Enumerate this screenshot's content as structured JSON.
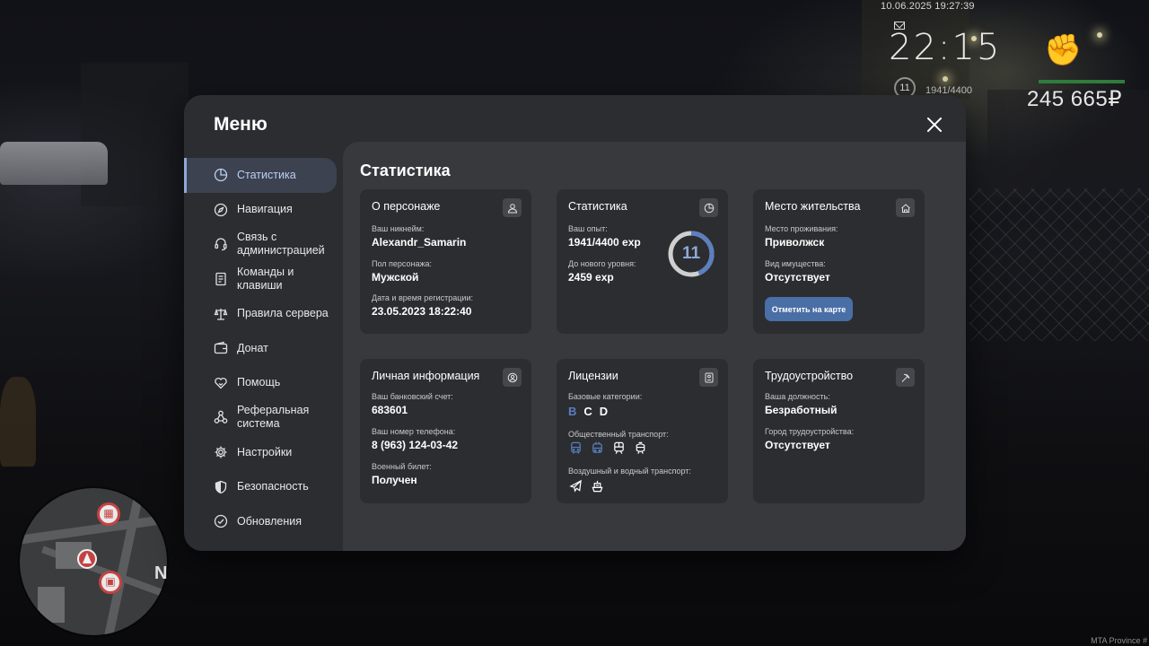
{
  "hud": {
    "datetime": "10.06.2025 19:27:39",
    "clock": "22:15",
    "level": "11",
    "level_exp": "1941/4400",
    "money": "245 665₽",
    "watermark": "MTA Province #",
    "north": "N"
  },
  "menu": {
    "title": "Меню",
    "sidebar": [
      {
        "label": "Статистика",
        "icon": "chart-pie-icon",
        "active": true
      },
      {
        "label": "Навигация",
        "icon": "compass-icon"
      },
      {
        "label": "Связь с администрацией",
        "icon": "headset-icon"
      },
      {
        "label": "Команды и клавиши",
        "icon": "document-icon"
      },
      {
        "label": "Правила сервера",
        "icon": "scales-icon"
      },
      {
        "label": "Донат",
        "icon": "wallet-icon"
      },
      {
        "label": "Помощь",
        "icon": "heart-hand-icon"
      },
      {
        "label": "Реферальная система",
        "icon": "network-icon"
      },
      {
        "label": "Настройки",
        "icon": "gear-icon"
      },
      {
        "label": "Безопасность",
        "icon": "shield-icon"
      },
      {
        "label": "Обновления",
        "icon": "check-circle-icon"
      }
    ],
    "content_title": "Статистика",
    "cards": {
      "character": {
        "title": "О персонаже",
        "nickname_label": "Ваш никнейм:",
        "nickname": "Alexandr_Samarin",
        "gender_label": "Пол персонажа:",
        "gender": "Мужской",
        "reg_label": "Дата и время регистрации:",
        "reg": "23.05.2023 18:22:40"
      },
      "stats": {
        "title": "Статистика",
        "exp_label": "Ваш опыт:",
        "exp": "1941/4400 exp",
        "next_label": "До нового уровня:",
        "next": "2459 exp",
        "level": "11",
        "level_progress": 0.441
      },
      "residence": {
        "title": "Место жительства",
        "place_label": "Место проживания:",
        "place": "Приволжск",
        "property_label": "Вид имущества:",
        "property": "Отсутствует",
        "button": "Отметить на карте"
      },
      "personal": {
        "title": "Личная информация",
        "bank_label": "Ваш банковский счет:",
        "bank": "683601",
        "phone_label": "Ваш номер телефона:",
        "phone": "8 (963) 124-03-42",
        "military_label": "Военный билет:",
        "military": "Получен"
      },
      "licenses": {
        "title": "Лицензии",
        "basic_label": "Базовые категории:",
        "categories": [
          "B",
          "C",
          "D"
        ],
        "public_label": "Общественный транспорт:",
        "air_label": "Воздушный и водный транспорт:"
      },
      "employment": {
        "title": "Трудоустройство",
        "position_label": "Ваша должность:",
        "position": "Безработный",
        "city_label": "Город трудоустройства:",
        "city": "Отсутствует"
      }
    }
  },
  "colors": {
    "accent": "#8ea9d6",
    "button": "#4a6ea6",
    "license_active": "#5b7fbf"
  }
}
